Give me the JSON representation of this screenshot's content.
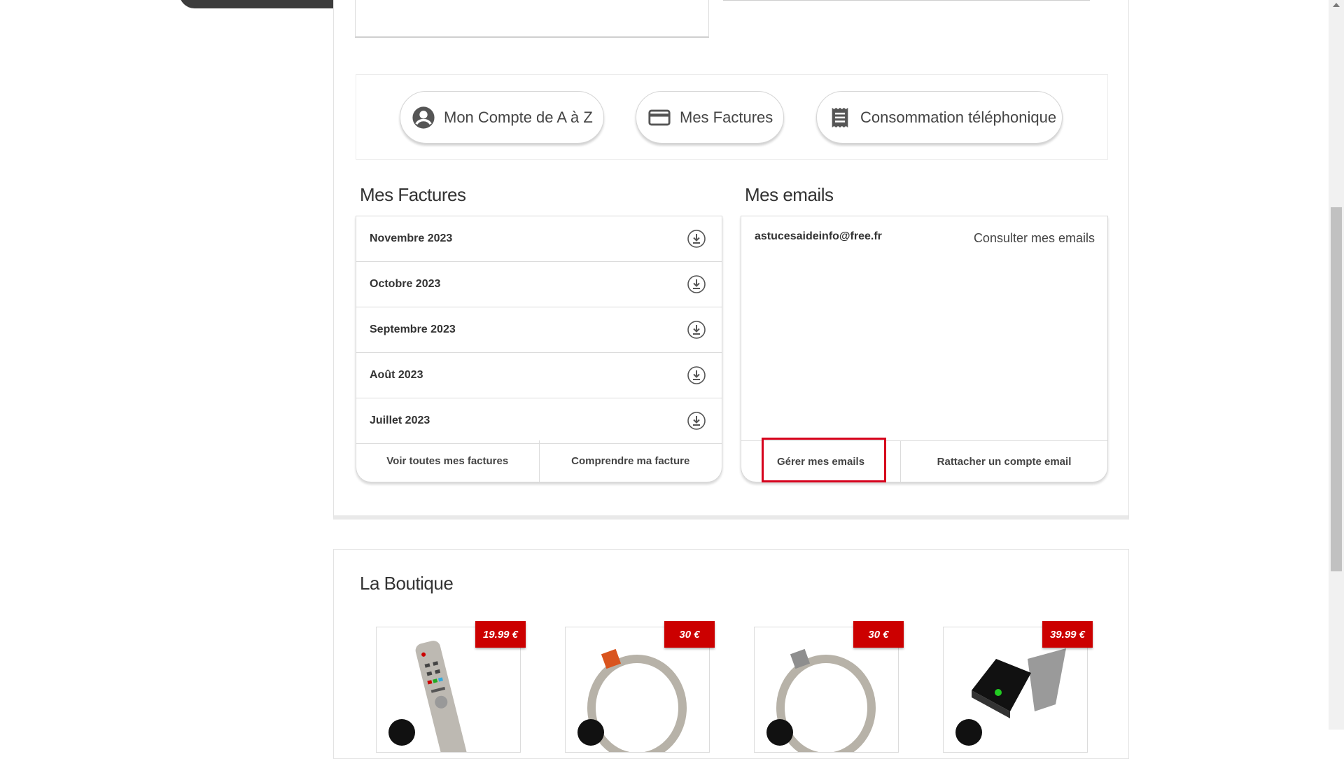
{
  "shortcuts": {
    "account_label": "Mon Compte de A à Z",
    "invoices_label": "Mes Factures",
    "consumption_label": "Consommation téléphonique"
  },
  "invoices": {
    "title": "Mes Factures",
    "months": [
      "Novembre 2023",
      "Octobre 2023",
      "Septembre 2023",
      "Août 2023",
      "Juillet 2023"
    ],
    "see_all_label": "Voir toutes mes factures",
    "understand_label": "Comprendre ma facture"
  },
  "emails": {
    "title": "Mes emails",
    "address": "astucesaideinfo@free.fr",
    "consult_label": "Consulter mes emails",
    "manage_label": "Gérer mes emails",
    "attach_label": "Rattacher un compte email"
  },
  "shop": {
    "title": "La Boutique",
    "products": [
      {
        "price": "19.99 €",
        "icon": "remote-control"
      },
      {
        "price": "30 €",
        "icon": "ring-red"
      },
      {
        "price": "30 €",
        "icon": "ring-grey"
      },
      {
        "price": "39.99 €",
        "icon": "black-box"
      }
    ]
  },
  "colors": {
    "accent": "#cc0000",
    "highlight": "#d6001c"
  }
}
